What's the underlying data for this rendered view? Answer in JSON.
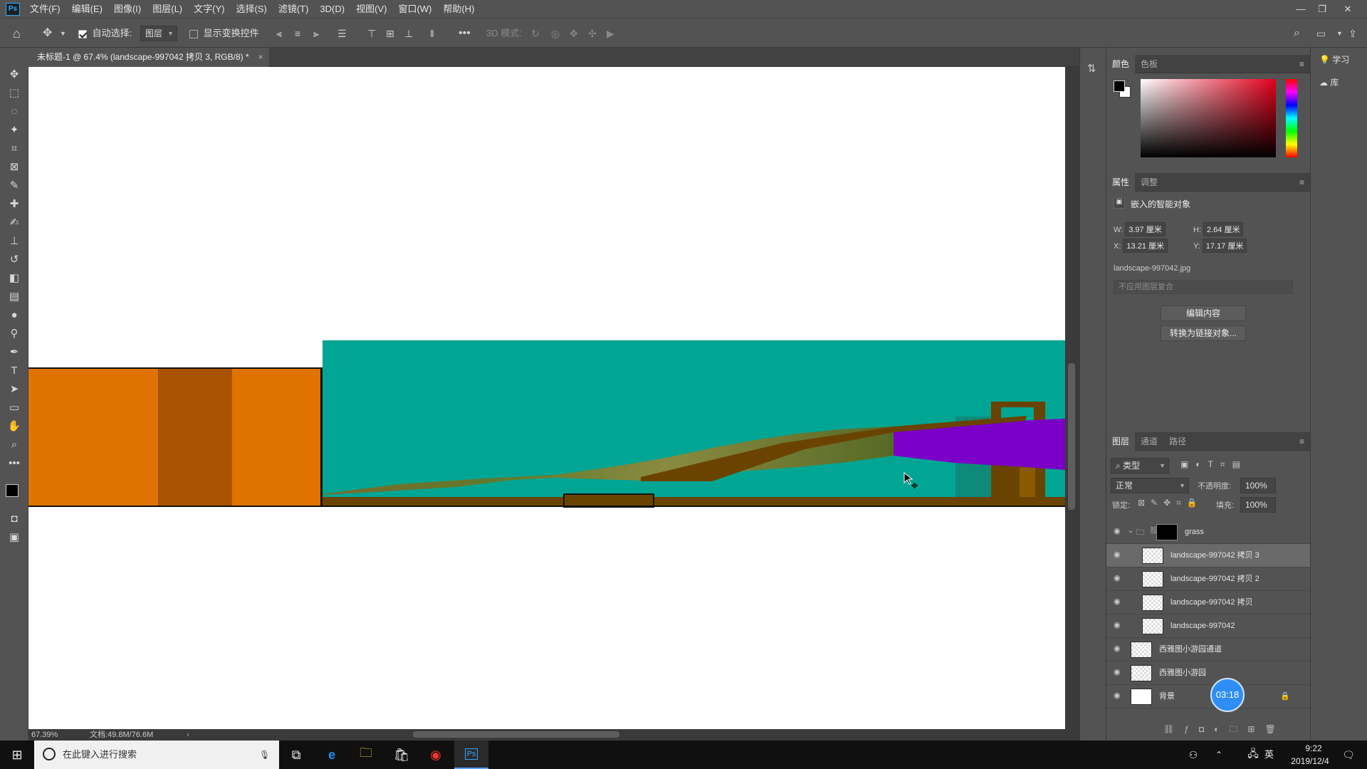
{
  "app": {
    "logo": "Ps"
  },
  "menubar": {
    "items": [
      "文件(F)",
      "编辑(E)",
      "图像(I)",
      "图层(L)",
      "文字(Y)",
      "选择(S)",
      "滤镜(T)",
      "3D(D)",
      "视图(V)",
      "窗口(W)",
      "帮助(H)"
    ]
  },
  "options": {
    "auto_select_label": "自动选择:",
    "auto_select_value": "图层",
    "show_transform_label": "显示变换控件",
    "mode_3d_label": "3D 模式:"
  },
  "document": {
    "tab_title": "未标题-1 @ 67.4% (landscape-997042 拷贝 3, RGB/8) *",
    "tab_close": "×",
    "zoom": "67.39%",
    "doc_size": "文档:49.8M/76.6M"
  },
  "colors": {
    "orange": "#E07300",
    "orange_dark": "#A95300",
    "teal": "#00A693",
    "purple": "#7A00C8",
    "brown": "#6B4300",
    "ps_blue": "#31A8FF"
  },
  "color_panel": {
    "tabs": [
      "颜色",
      "色板"
    ]
  },
  "properties_panel": {
    "tabs": [
      "属性",
      "调整"
    ],
    "object_type": "嵌入的智能对象",
    "w_label": "W:",
    "w_value": "3.97 厘米",
    "h_label": "H:",
    "h_value": "2.64 厘米",
    "x_label": "X:",
    "x_value": "13.21 厘米",
    "y_label": "Y:",
    "y_value": "17.17 厘米",
    "filename": "landscape-997042.jpg",
    "comp_placeholder": "不应用图层复合",
    "edit_button": "编辑内容",
    "convert_button": "转换为链接对象..."
  },
  "layers_panel": {
    "tabs": [
      "图层",
      "通道",
      "路径"
    ],
    "filter_label": "类型",
    "blend_mode": "正常",
    "opacity_label": "不透明度:",
    "opacity_value": "100%",
    "lock_label": "锁定:",
    "fill_label": "填充:",
    "fill_value": "100%",
    "layers": [
      {
        "name": "grass"
      },
      {
        "name": "landscape-997042 拷贝 3"
      },
      {
        "name": "landscape-997042 拷贝 2"
      },
      {
        "name": "landscape-997042 拷贝"
      },
      {
        "name": "landscape-997042"
      },
      {
        "name": "西雅图小游园通道"
      },
      {
        "name": "西雅图小游园"
      },
      {
        "name": "背景"
      }
    ]
  },
  "right_strip": {
    "learn": "学习",
    "library": "库"
  },
  "timer_badge": "03:18",
  "taskbar": {
    "search_placeholder": "在此键入进行搜索",
    "ime": "英",
    "time": "9:22",
    "date": "2019/12/4"
  }
}
